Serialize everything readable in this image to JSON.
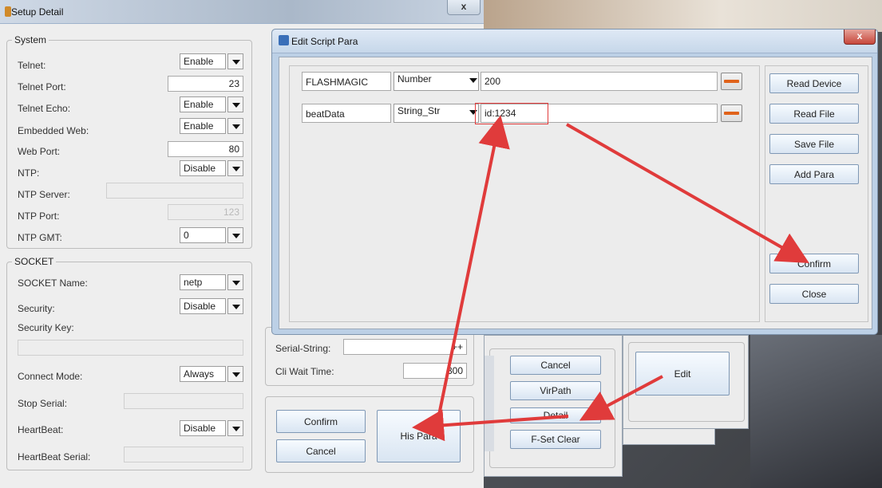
{
  "setup_window": {
    "title": "Setup Detail",
    "close_label": "x",
    "system": {
      "group_title": "System",
      "telnet_label": "Telnet:",
      "telnet_value": "Enable",
      "telnet_port_label": "Telnet Port:",
      "telnet_port_value": "23",
      "telnet_echo_label": "Telnet Echo:",
      "telnet_echo_value": "Enable",
      "embedded_web_label": "Embedded Web:",
      "embedded_web_value": "Enable",
      "web_port_label": "Web Port:",
      "web_port_value": "80",
      "ntp_label": "NTP:",
      "ntp_value": "Disable",
      "ntp_server_label": "NTP Server:",
      "ntp_port_label": "NTP Port:",
      "ntp_port_value": "123",
      "ntp_gmt_label": "NTP GMT:",
      "ntp_gmt_value": "0"
    },
    "socket": {
      "group_title": "SOCKET",
      "socket_name_label": "SOCKET Name:",
      "socket_name_value": "netp",
      "security_label": "Security:",
      "security_value": "Disable",
      "security_key_label": "Security Key:",
      "connect_mode_label": "Connect Mode:",
      "connect_mode_value": "Always",
      "stop_serial_label": "Stop Serial:",
      "heartbeat_label": "HeartBeat:",
      "heartbeat_value": "Disable",
      "heartbeat_serial_label": "HeartBeat Serial:"
    },
    "serial_string_label": "Serial-String:",
    "serial_string_value": "++",
    "cli_wait_label": "Cli Wait Time:",
    "cli_wait_value": "300",
    "confirm_label": "Confirm",
    "cancel_label": "Cancel",
    "his_para_label": "His Para"
  },
  "mid_window": {
    "cancel_label": "Cancel",
    "virpath_label": "VirPath",
    "detail_label": "Detail",
    "fset_clear_label": "F-Set Clear"
  },
  "right_window": {
    "edit_label": "Edit"
  },
  "edit_dialog": {
    "title": "Edit Script Para",
    "close_label": "x",
    "rows": [
      {
        "name": "FLASHMAGIC",
        "type": "Number",
        "value": "200"
      },
      {
        "name": "beatData",
        "type": "String_Str",
        "value": "id:1234"
      }
    ],
    "buttons": {
      "read_device": "Read Device",
      "read_file": "Read File",
      "save_file": "Save File",
      "add_para": "Add Para",
      "confirm": "Confirm",
      "close": "Close"
    }
  },
  "colors": {
    "annotation_red": "#e03b3b",
    "accent_minus": "#e0621a"
  }
}
